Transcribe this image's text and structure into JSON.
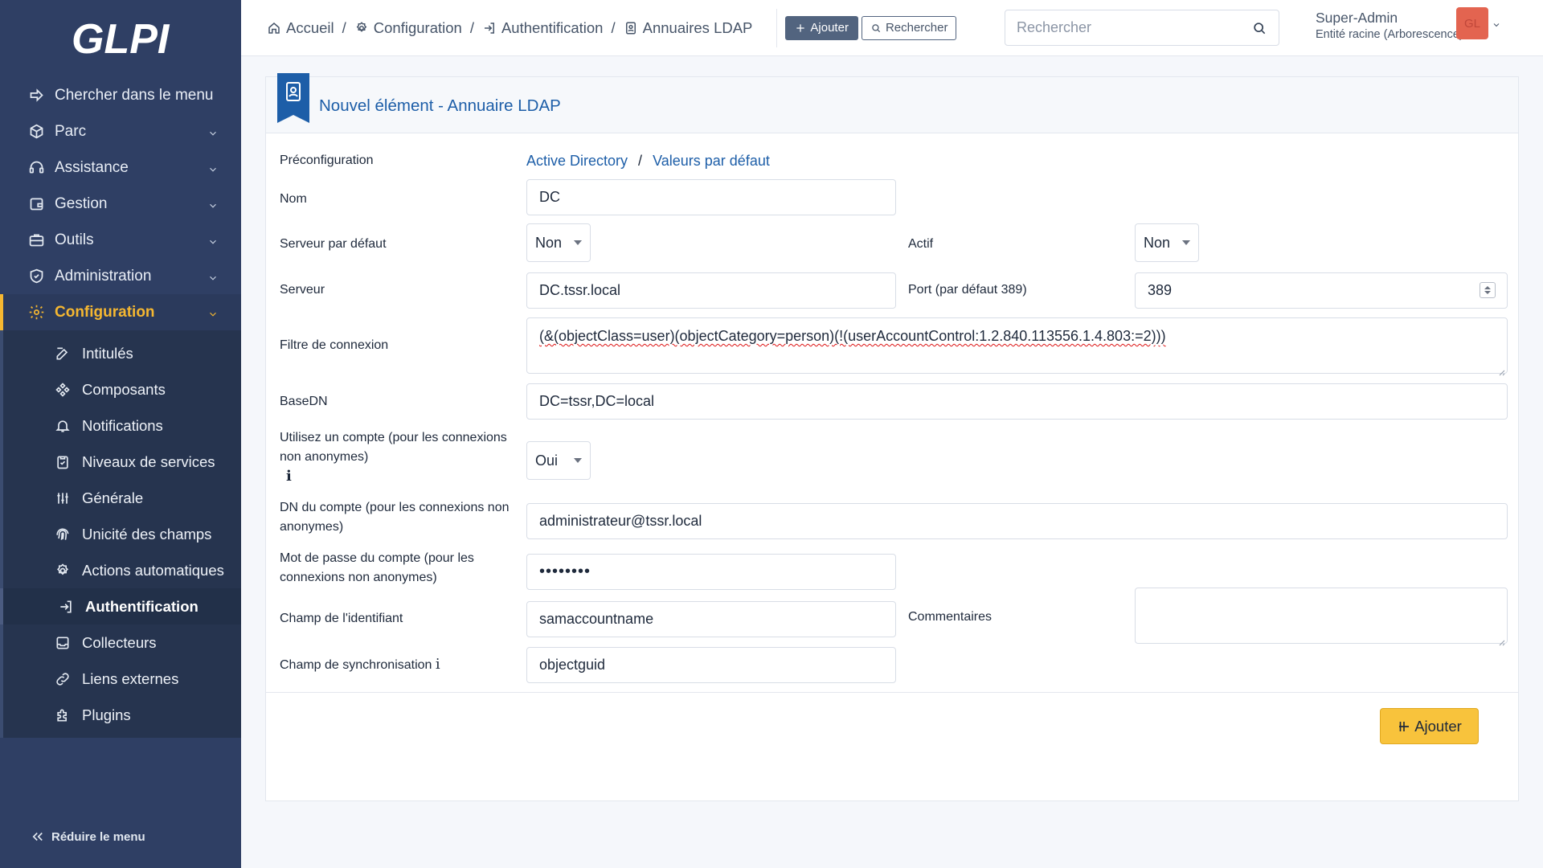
{
  "app": {
    "logo_text": "GLPI"
  },
  "sidebar": {
    "search_menu": "Chercher dans le menu",
    "items": [
      {
        "label": "Parc",
        "icon": "box-icon"
      },
      {
        "label": "Assistance",
        "icon": "headset-icon"
      },
      {
        "label": "Gestion",
        "icon": "wallet-icon"
      },
      {
        "label": "Outils",
        "icon": "briefcase-icon"
      },
      {
        "label": "Administration",
        "icon": "shield-icon"
      },
      {
        "label": "Configuration",
        "icon": "gear-icon",
        "active": true
      }
    ],
    "subitems": [
      {
        "label": "Intitulés",
        "icon": "edit-icon"
      },
      {
        "label": "Composants",
        "icon": "components-icon"
      },
      {
        "label": "Notifications",
        "icon": "bell-icon"
      },
      {
        "label": "Niveaux de services",
        "icon": "checklist-icon"
      },
      {
        "label": "Générale",
        "icon": "sliders-icon"
      },
      {
        "label": "Unicité des champs",
        "icon": "fingerprint-icon"
      },
      {
        "label": "Actions automatiques",
        "icon": "gear-icon"
      },
      {
        "label": "Authentification",
        "icon": "login-icon",
        "active": true
      },
      {
        "label": "Collecteurs",
        "icon": "inbox-icon"
      },
      {
        "label": "Liens externes",
        "icon": "link-icon"
      },
      {
        "label": "Plugins",
        "icon": "puzzle-icon"
      }
    ],
    "collapse": "Réduire le menu"
  },
  "topbar": {
    "breadcrumb": [
      "Accueil",
      "Configuration",
      "Authentification",
      "Annuaires LDAP"
    ],
    "add_label": "Ajouter",
    "search_label": "Rechercher",
    "search_placeholder": "Rechercher",
    "user_name": "Super-Admin",
    "user_entity": "Entité racine (Arborescence)",
    "avatar_initials": "GL"
  },
  "form": {
    "title": "Nouvel élément - Annuaire LDAP",
    "preconfig_label": "Préconfiguration",
    "preconfig_ad": "Active Directory",
    "preconfig_sep": "/",
    "preconfig_default": "Valeurs par défaut",
    "name_label": "Nom",
    "name_value": "DC",
    "default_server_label": "Serveur par défaut",
    "default_server_value": "Non",
    "active_label": "Actif",
    "active_value": "Non",
    "server_label": "Serveur",
    "server_value": "DC.tssr.local",
    "port_label": "Port (par défaut 389)",
    "port_value": "389",
    "filter_label": "Filtre de connexion",
    "filter_value": "(&(objectClass=user)(objectCategory=person)(!(userAccountControl:1.2.840.113556.1.4.803:=2)))",
    "basedn_label": "BaseDN",
    "basedn_value": "DC=tssr,DC=local",
    "use_account_label": "Utilisez un compte (pour les connexions non anonymes)",
    "use_account_value": "Oui",
    "info_glyph": "i",
    "account_dn_label": "DN du compte (pour les connexions non anonymes)",
    "account_dn_value": "administrateur@tssr.local",
    "password_label": "Mot de passe du compte (pour les connexions non anonymes)",
    "password_value": "••••••••",
    "login_field_label": "Champ de l'identifiant",
    "login_field_value": "samaccountname",
    "comments_label": "Commentaires",
    "comments_value": "",
    "sync_field_label": "Champ de synchronisation",
    "sync_field_value": "objectguid",
    "submit_label": "Ajouter"
  }
}
